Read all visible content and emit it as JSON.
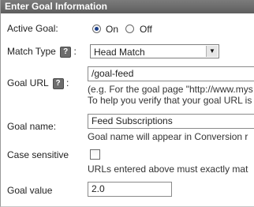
{
  "header": {
    "title": "Enter Goal Information"
  },
  "active_goal": {
    "label": "Active Goal:",
    "on_label": "On",
    "off_label": "Off",
    "selected": "On"
  },
  "match_type": {
    "label": "Match Type",
    "help": "?",
    "colon": ":",
    "value": "Head Match"
  },
  "goal_url": {
    "label": "Goal URL",
    "help": "?",
    "colon": ":",
    "value": "/goal-feed",
    "hint1": "(e.g. For the goal page \"http://www.mys",
    "hint2": "To help you verify that your goal URL is"
  },
  "goal_name": {
    "label": "Goal name:",
    "value": "Feed Subscriptions",
    "hint": "Goal name will appear in Conversion r"
  },
  "case_sensitive": {
    "label": "Case sensitive",
    "checked": false,
    "hint": "URLs entered above must exactly mat"
  },
  "goal_value": {
    "label": "Goal value",
    "value": "2.0"
  }
}
